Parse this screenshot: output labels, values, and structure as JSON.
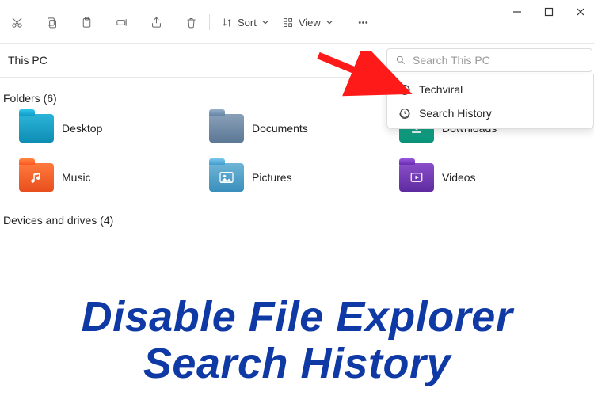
{
  "window": {
    "minimize": "—",
    "maximize": "▢",
    "close": "✕"
  },
  "toolbar": {
    "sort_label": "Sort",
    "view_label": "View"
  },
  "address": {
    "location": "This PC"
  },
  "search": {
    "placeholder": "Search This PC",
    "history": [
      "Techviral",
      "Search History"
    ]
  },
  "sections": {
    "folders_header": "Folders (6)",
    "devices_header": "Devices and drives (4)"
  },
  "folders": [
    {
      "label": "Desktop"
    },
    {
      "label": "Documents"
    },
    {
      "label": "Downloads"
    },
    {
      "label": "Music"
    },
    {
      "label": "Pictures"
    },
    {
      "label": "Videos"
    }
  ],
  "overlay": {
    "headline_line1": "Disable File Explorer",
    "headline_line2": "Search History"
  }
}
